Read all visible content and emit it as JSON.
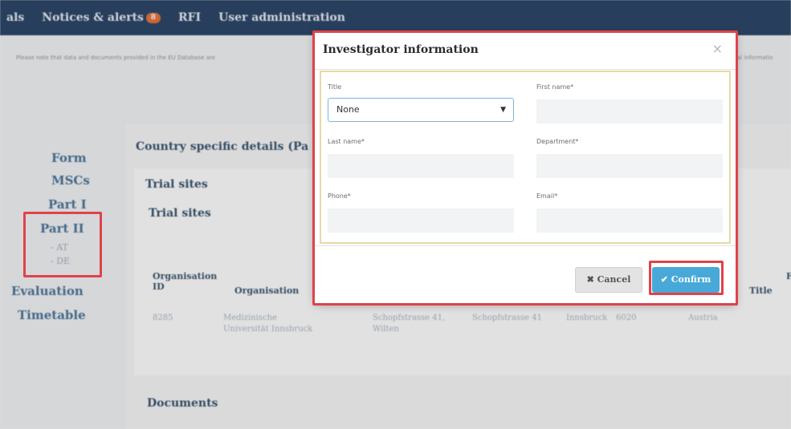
{
  "topnav": {
    "items": [
      "als",
      "Notices & alerts",
      "RFI",
      "User administration"
    ],
    "alerts_badge": "8"
  },
  "notice": {
    "text": "Please note that data and documents provided in the EU Database are",
    "right_text": "al informatio"
  },
  "leftnav": {
    "form": "Form",
    "mscs": "MSCs",
    "part1": "Part I",
    "part2": "Part II",
    "sub_a1": "- AT",
    "sub_de": "- DE",
    "evaluation": "Evaluation",
    "timetable": "Timetable"
  },
  "content": {
    "title": "Country specific details (Pa",
    "trial_sites_tab": "Trial sites",
    "trial_sites_heading": "Trial sites",
    "columns": [
      "Organisation ID",
      "Organisation",
      "Title",
      "F"
    ],
    "row": {
      "org_id": "8285",
      "org_name": "Medizinische Universität Innsbruck",
      "address": "Schopfstrasse 41, Wilten",
      "street": "Schopfstrasse 41",
      "city": "Innsbruck",
      "postcode": "6020",
      "country": "Austria"
    },
    "documents_heading": "Documents"
  },
  "modal": {
    "title": "Investigator information",
    "close_symbol": "×",
    "fields": {
      "title_label": "Title",
      "title_value": "None",
      "first_name_label": "First name*",
      "last_name_label": "Last name*",
      "department_label": "Department*",
      "phone_label": "Phone*",
      "email_label": "Email*"
    },
    "cancel_label": "✖ Cancel",
    "confirm_label": "✔ Confirm"
  },
  "colors": {
    "nav_bg": "#1d3a5f",
    "highlight": "#e0424a",
    "confirm": "#48a9d8",
    "link": "#3f6d94"
  }
}
